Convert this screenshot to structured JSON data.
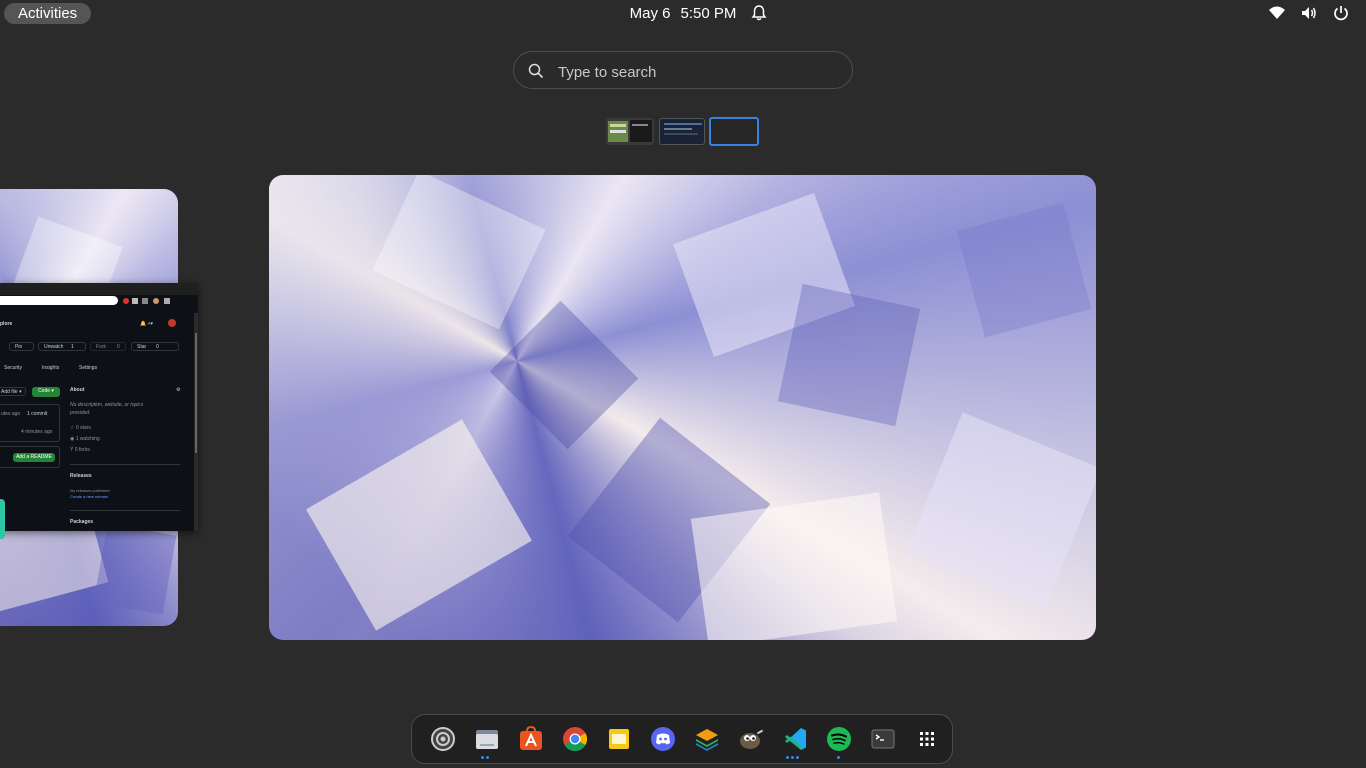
{
  "topbar": {
    "activities_label": "Activities",
    "date": "May 6",
    "time": "5:50 PM",
    "status_icons": [
      "notification-bell-icon",
      "wifi-icon",
      "volume-icon",
      "power-icon"
    ]
  },
  "search": {
    "placeholder": "Type to search"
  },
  "workspaces": {
    "count": 3,
    "active_index": 2
  },
  "left_window": {
    "browser": {
      "repo_name": "plore",
      "buttons": [
        "Pin",
        "Unwatch",
        "1",
        "Fork",
        "0",
        "Star",
        "0"
      ],
      "tabs": [
        "Security",
        "Insights",
        "Settings"
      ],
      "add_file_label": "Add file ▾",
      "code_label": "Code ▾",
      "commit_time": "utes ago",
      "commit_count": "1 commit",
      "file_time": "4 minutes ago",
      "add_readme_label": "Add a README",
      "about_title": "About",
      "about_desc_1": "No description, website, or topics",
      "about_desc_2": "provided.",
      "stars": "0 stars",
      "watching": "1 watching",
      "forks": "0 forks",
      "releases_title": "Releases",
      "no_releases": "No releases published",
      "create_release": "Create a new release",
      "packages_title": "Packages"
    }
  },
  "dock": {
    "items": [
      {
        "name": "settings",
        "running_dots": 0
      },
      {
        "name": "files",
        "running_dots": 2
      },
      {
        "name": "software-center",
        "running_dots": 0
      },
      {
        "name": "chrome",
        "running_dots": 0
      },
      {
        "name": "notes",
        "running_dots": 0
      },
      {
        "name": "discord",
        "running_dots": 0
      },
      {
        "name": "stacks",
        "running_dots": 0
      },
      {
        "name": "gimp",
        "running_dots": 0
      },
      {
        "name": "vscode",
        "running_dots": 3
      },
      {
        "name": "spotify",
        "running_dots": 1
      },
      {
        "name": "terminal",
        "running_dots": 0
      },
      {
        "name": "show-apps",
        "running_dots": 0
      }
    ]
  },
  "colors": {
    "accent": "#3584e4",
    "background": "#2b2b2b",
    "github_green": "#238636"
  }
}
